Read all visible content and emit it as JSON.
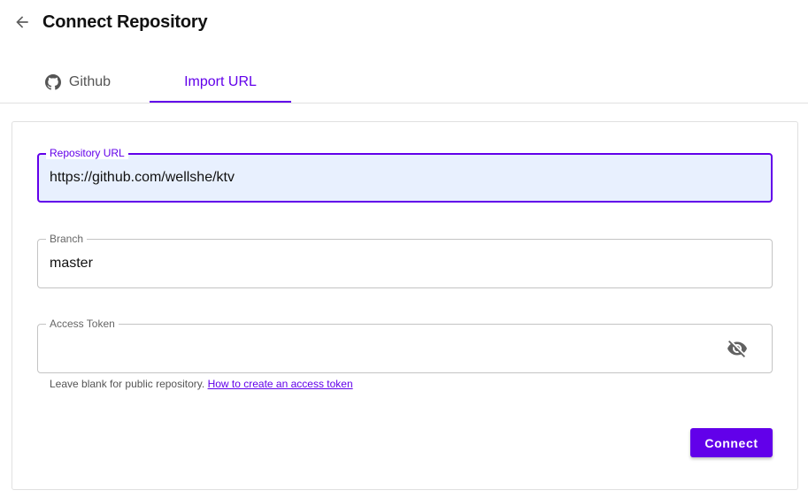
{
  "header": {
    "title": "Connect Repository",
    "back_icon": "arrow-left-icon"
  },
  "tabs": [
    {
      "label": "Github",
      "icon": "github-icon",
      "active": false
    },
    {
      "label": "Import URL",
      "active": true
    }
  ],
  "form": {
    "repository_url": {
      "label": "Repository URL",
      "value": "https://github.com/wellshe/ktv",
      "focused": true
    },
    "branch": {
      "label": "Branch",
      "value": "master"
    },
    "access_token": {
      "label": "Access Token",
      "value": "",
      "toggle_icon": "eye-off-icon"
    },
    "helper_text": "Leave blank for public repository.",
    "helper_link": "How to create an access token",
    "submit_label": "Connect"
  },
  "colors": {
    "accent": "#6200ea",
    "focused_field_bg": "#e8f0fe",
    "border": "#c4c4c4"
  }
}
